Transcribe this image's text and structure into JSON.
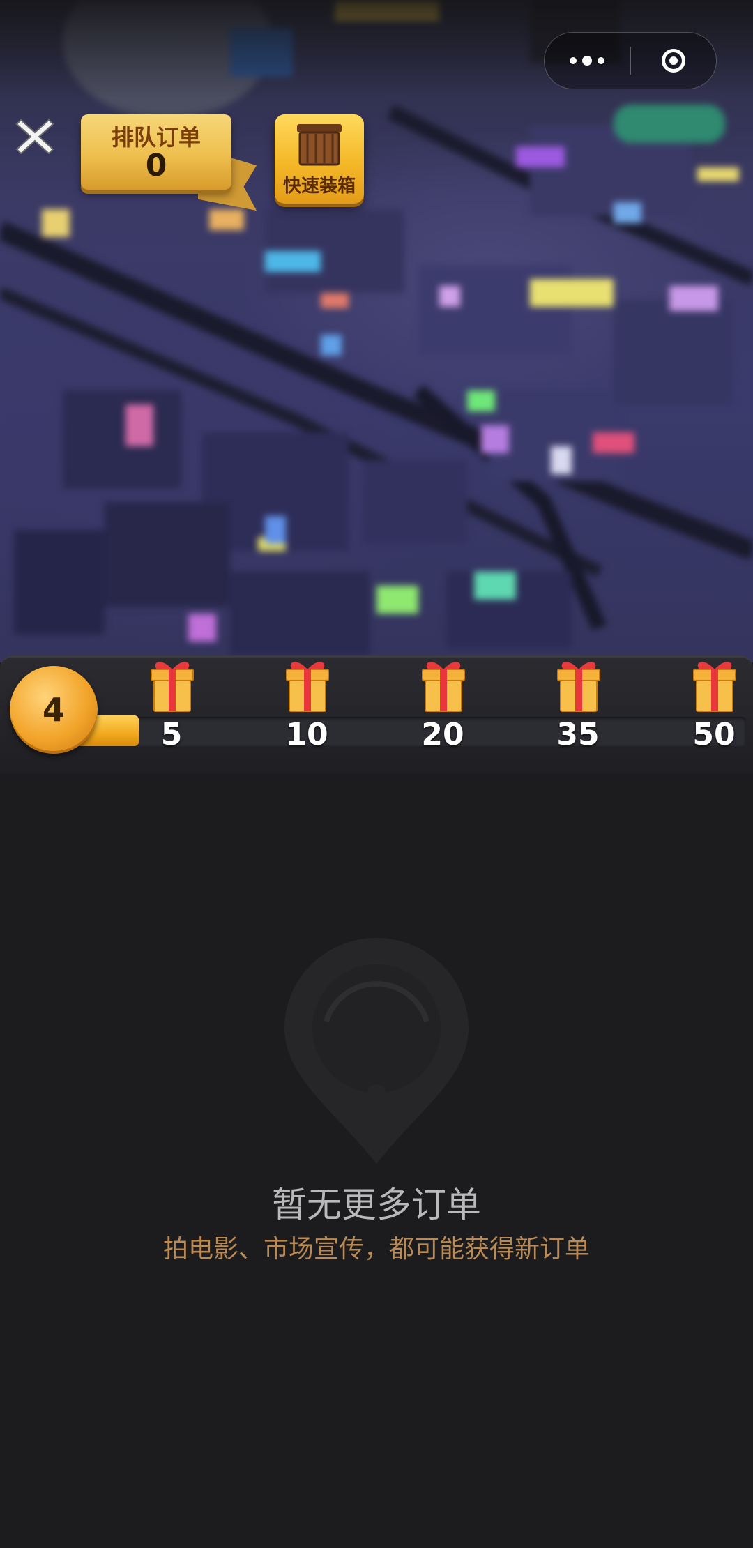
{
  "header": {
    "capsule": {
      "more_icon": "more-dots-icon",
      "close_icon": "target-close-icon"
    },
    "close_icon": "close-x-icon"
  },
  "queue": {
    "label": "排队订单",
    "count": "0"
  },
  "quick_pack": {
    "label": "快速装箱",
    "icon": "crate-icon"
  },
  "progress": {
    "level": "4",
    "fill_fraction": 0.044,
    "milestones": [
      {
        "value": "5",
        "icon": "gift-icon"
      },
      {
        "value": "10",
        "icon": "gift-icon"
      },
      {
        "value": "20",
        "icon": "gift-icon"
      },
      {
        "value": "35",
        "icon": "gift-icon"
      },
      {
        "value": "50",
        "icon": "gift-icon"
      }
    ]
  },
  "empty_state": {
    "icon": "location-pin-icon",
    "title": "暂无更多订单",
    "hint": "拍电影、市场宣传，都可能获得新订单"
  },
  "colors": {
    "background": "#1c1c1e",
    "gold": "#f2a91e",
    "hint_text": "#b98a55",
    "title_text": "#b9b9bc"
  }
}
